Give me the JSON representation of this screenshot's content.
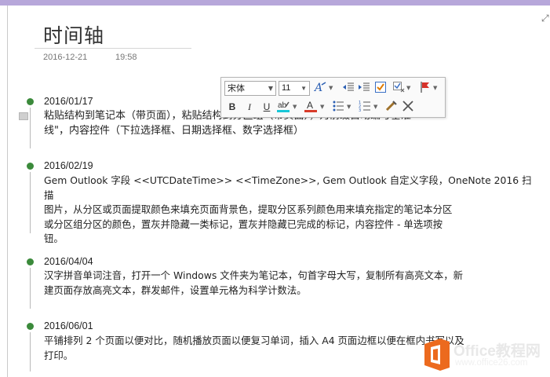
{
  "page": {
    "title": "时间轴",
    "date": "2016-12-21",
    "time": "19:58"
  },
  "toolbar": {
    "font": "宋体",
    "size": "11",
    "buttons": [
      "bold",
      "italic",
      "underline",
      "highlight",
      "font-color",
      "bullets",
      "numbering",
      "format-painter",
      "clear-formatting",
      "styles",
      "decrease-indent",
      "increase-indent",
      "to-do-tag",
      "tags",
      "flag"
    ]
  },
  "entries": [
    {
      "date": "2016/01/17",
      "text_lines": [
        "粘贴结构到笔记本（带页面），粘贴结构到分区组（带页面），为前缀自动编号基准",
        "线\"，内容控件（下拉选择框、日期选择框、数字选择框）"
      ]
    },
    {
      "date": "2016/02/19",
      "text_lines": [
        "Gem Outlook 字段 <<UTCDateTime>> <<TimeZone>>, Gem Outlook 自定义字段，OneNote 2016 扫描",
        "图片，从分区或页面提取颜色来填充页面背景色，提取分区系列颜色用来填充指定的笔记本分区",
        "或分区组分区的颜色，置灰并隐藏一类标记，置灰并隐藏已完成的标记，内容控件 - 单选项按",
        "钮。"
      ]
    },
    {
      "date": "2016/04/04",
      "text_lines": [
        "汉字拼音单词注音，打开一个 Windows 文件夹为笔记本，句首字母大写，复制所有高亮文本，新",
        "建页面存放高亮文本，群发邮件，设置单元格为科学计数法。"
      ]
    },
    {
      "date": "2016/06/01",
      "text_lines": [
        "平铺排列 2 个页面以便对比，随机播放页面以便复习单词，插入 A4 页面边框以便在框内书写以及",
        "打印。"
      ]
    }
  ],
  "watermark": {
    "brand": "Office教程网",
    "url": "www.office26.com"
  },
  "colors": {
    "top_bar": "#b7a7da",
    "timeline_dot": "#3b8a3b",
    "logo_orange": "#ec6a1e"
  }
}
